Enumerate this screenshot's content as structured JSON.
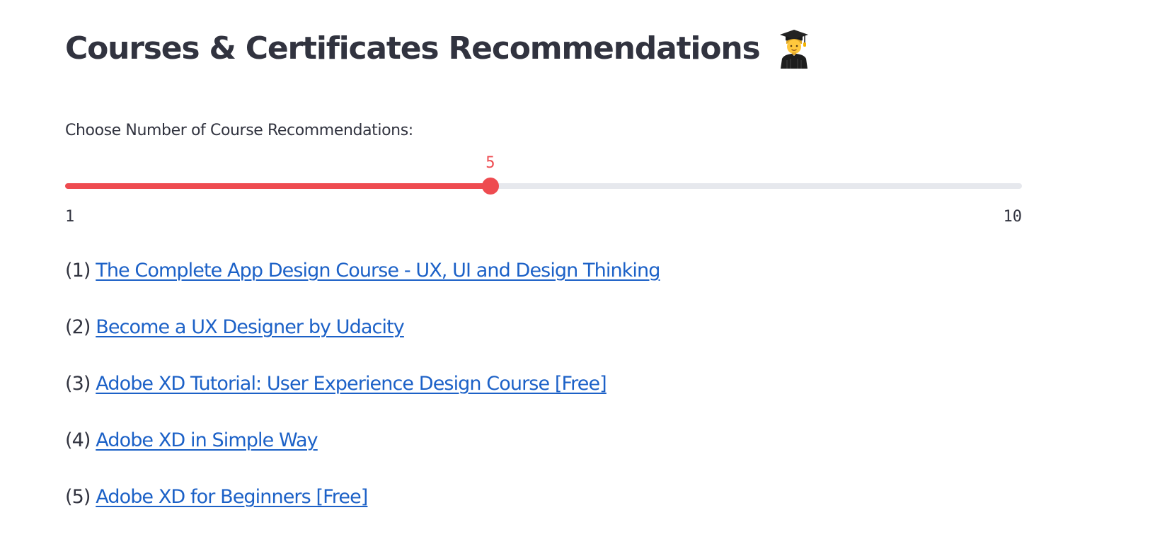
{
  "page": {
    "title": "Courses & Certificates Recommendations",
    "title_icon": "graduate-emoji-icon"
  },
  "slider": {
    "label": "Choose Number of Course Recommendations:",
    "min": 1,
    "max": 10,
    "value": 5,
    "min_label": "1",
    "max_label": "10",
    "value_label": "5",
    "accent_color": "#ee4b50",
    "track_color": "#e6e8ed"
  },
  "courses": [
    {
      "prefix": "(1)",
      "title": "The Complete App Design Course - UX, UI and Design Thinking"
    },
    {
      "prefix": "(2)",
      "title": "Become a UX Designer by Udacity"
    },
    {
      "prefix": "(3)",
      "title": "Adobe XD Tutorial: User Experience Design Course [Free]"
    },
    {
      "prefix": "(4)",
      "title": "Adobe XD in Simple Way"
    },
    {
      "prefix": "(5)",
      "title": "Adobe XD for Beginners [Free]"
    }
  ],
  "colors": {
    "text": "#31333f",
    "link": "#1c61c7",
    "background": "#ffffff"
  }
}
